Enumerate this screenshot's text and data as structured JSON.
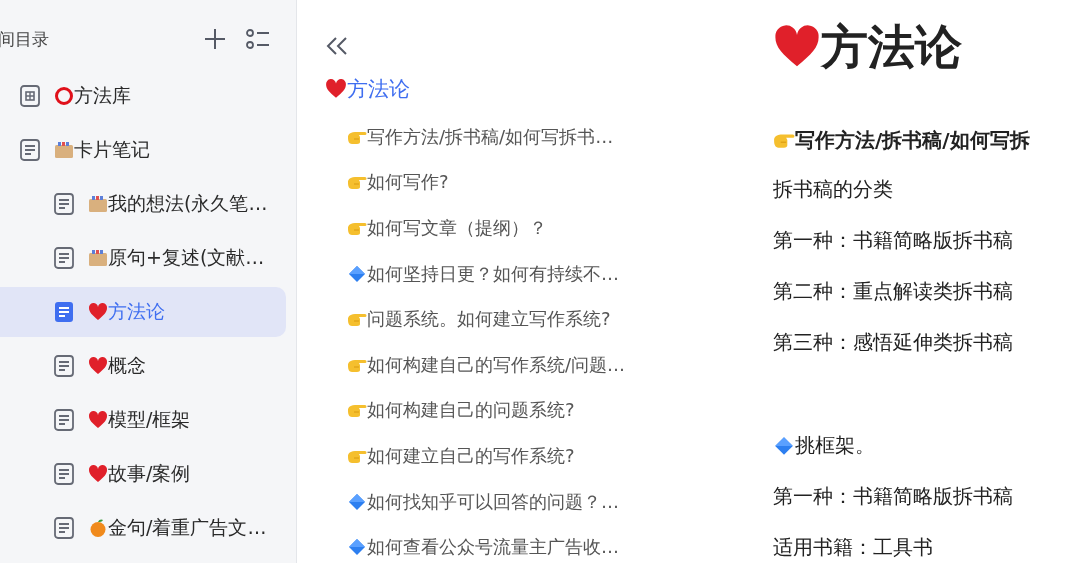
{
  "sidebar": {
    "title": "间目录",
    "items": [
      {
        "kind": "library",
        "emoji": {
          "kind": "ring"
        },
        "label": "方法库",
        "selected": false
      },
      {
        "kind": "doc",
        "emoji": {
          "kind": "card-box"
        },
        "label": "卡片笔记",
        "selected": false,
        "children": [
          {
            "kind": "doc",
            "emoji": {
              "kind": "card-box"
            },
            "label": "我的想法(永久笔…",
            "selected": false
          },
          {
            "kind": "doc",
            "emoji": {
              "kind": "card-box"
            },
            "label": "原句+复述(文献…",
            "selected": false
          },
          {
            "kind": "doc",
            "emoji": {
              "kind": "heart"
            },
            "label": "方法论",
            "selected": true
          },
          {
            "kind": "doc",
            "emoji": {
              "kind": "heart"
            },
            "label": "概念",
            "selected": false
          },
          {
            "kind": "doc",
            "emoji": {
              "kind": "heart"
            },
            "label": "模型/框架",
            "selected": false
          },
          {
            "kind": "doc",
            "emoji": {
              "kind": "heart"
            },
            "label": "故事/案例",
            "selected": false
          },
          {
            "kind": "doc",
            "emoji": {
              "kind": "orange"
            },
            "label": "金句/着重广告文…",
            "selected": false
          }
        ]
      }
    ]
  },
  "outline": {
    "title": {
      "emoji": {
        "kind": "heart"
      },
      "text": "方法论"
    },
    "items": [
      {
        "emoji": {
          "kind": "finger"
        },
        "text": "写作方法/拆书稿/如何写拆书…"
      },
      {
        "emoji": {
          "kind": "finger"
        },
        "text": "如何写作?"
      },
      {
        "emoji": {
          "kind": "finger"
        },
        "text": "如何写文章（提纲）？"
      },
      {
        "emoji": {
          "kind": "diamond"
        },
        "text": "如何坚持日更？如何有持续不…"
      },
      {
        "emoji": {
          "kind": "finger"
        },
        "text": "问题系统。如何建立写作系统?"
      },
      {
        "emoji": {
          "kind": "finger"
        },
        "text": "如何构建自己的写作系统/问题…"
      },
      {
        "emoji": {
          "kind": "finger"
        },
        "text": "如何构建自己的问题系统?"
      },
      {
        "emoji": {
          "kind": "finger"
        },
        "text": "如何建立自己的写作系统?"
      },
      {
        "emoji": {
          "kind": "diamond"
        },
        "text": "如何找知乎可以回答的问题？…"
      },
      {
        "emoji": {
          "kind": "diamond"
        },
        "text": "如何查看公众号流量主广告收…"
      }
    ]
  },
  "document": {
    "title": {
      "emoji": {
        "kind": "heart"
      },
      "text": "方法论"
    },
    "lines": [
      {
        "kind": "heading",
        "emoji": {
          "kind": "finger"
        },
        "text": "写作方法/拆书稿/如何写拆"
      },
      {
        "kind": "text",
        "text": "拆书稿的分类"
      },
      {
        "kind": "text",
        "text": "第一种：书籍简略版拆书稿"
      },
      {
        "kind": "text",
        "text": "第二种：重点解读类拆书稿"
      },
      {
        "kind": "text",
        "text": "第三种：感悟延伸类拆书稿"
      },
      {
        "kind": "blank"
      },
      {
        "kind": "text",
        "emoji": {
          "kind": "diamond"
        },
        "text": "挑框架。"
      },
      {
        "kind": "text",
        "text": "第一种：书籍简略版拆书稿"
      },
      {
        "kind": "text",
        "text": "适用书籍：工具书"
      }
    ]
  }
}
